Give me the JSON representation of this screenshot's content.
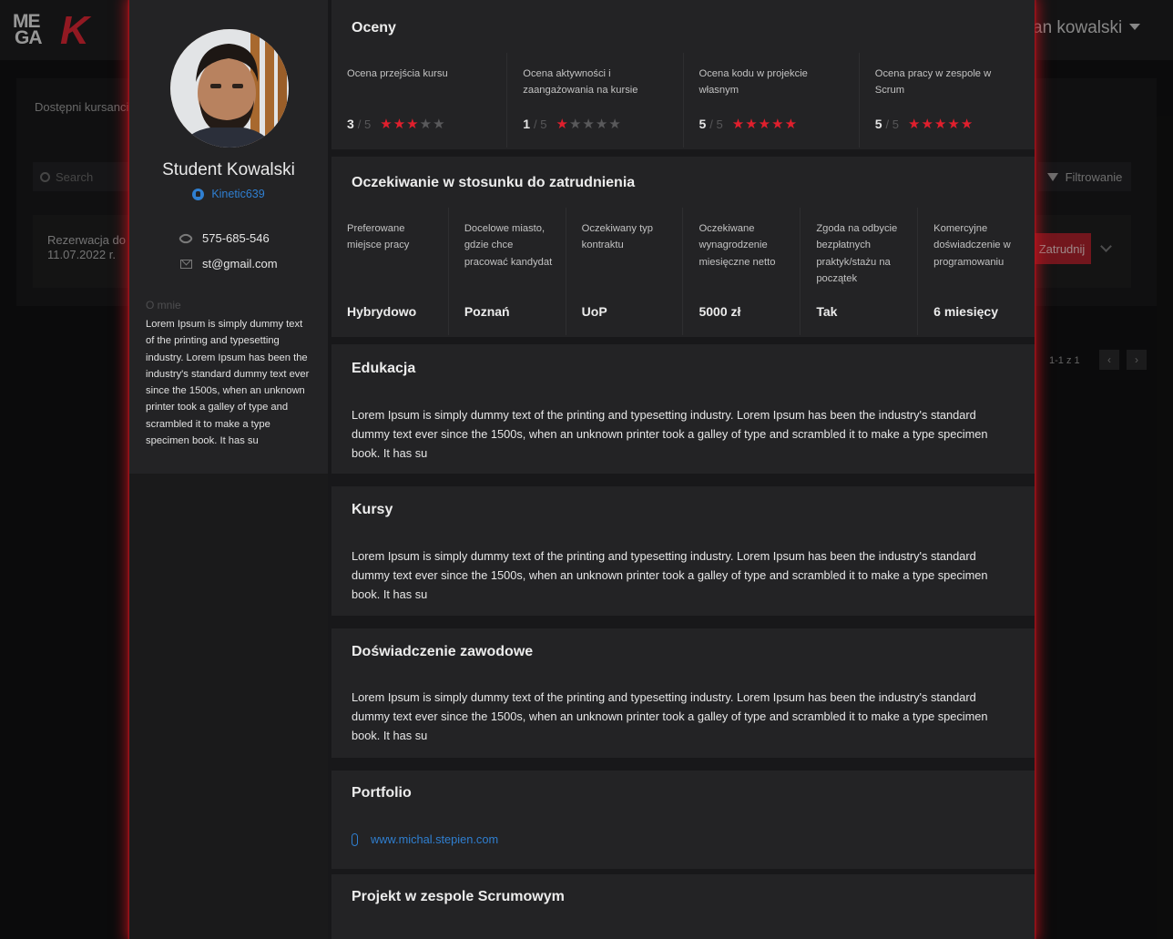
{
  "header": {
    "logo_line1": "ME",
    "logo_line2": "GA",
    "logo_k": "K",
    "user_name": "an kowalski"
  },
  "background": {
    "tab_label": "Dostępni kursanci",
    "search_placeholder": "Search",
    "filter_label": "Filtrowanie",
    "row_date": "Rezerwacja do 11.07.2022 r.",
    "hire_label": "Zatrudnij",
    "pager_text": "1-1 z 1"
  },
  "profile": {
    "name": "Student Kowalski",
    "github": "Kinetic639",
    "phone": "575-685-546",
    "email": "st@gmail.com",
    "about_title": "O mnie",
    "about_text": "Lorem Ipsum is simply dummy text of the printing and typesetting industry. Lorem Ipsum has been the industry's standard dummy text ever since the 1500s, when an unknown printer took a galley of type and scrambled it to make a type specimen book. It has su"
  },
  "grades": {
    "title": "Oceny",
    "max_label": "/ 5",
    "items": [
      {
        "label": "Ocena przejścia kursu",
        "value": "3",
        "score": 3
      },
      {
        "label": "Ocena aktywności i zaangażowania na kursie",
        "value": "1",
        "score": 1
      },
      {
        "label": "Ocena kodu w projekcie własnym",
        "value": "5",
        "score": 5
      },
      {
        "label": "Ocena pracy w zespole w Scrum",
        "value": "5",
        "score": 5
      }
    ]
  },
  "expectations": {
    "title": "Oczekiwanie w stosunku do zatrudnienia",
    "items": [
      {
        "label": "Preferowane miejsce pracy",
        "value": "Hybrydowo"
      },
      {
        "label": "Docelowe miasto, gdzie chce pracować kandydat",
        "value": "Poznań"
      },
      {
        "label": "Oczekiwany typ kontraktu",
        "value": "UoP"
      },
      {
        "label": "Oczekiwane wynagrodzenie miesięczne netto",
        "value": "5000 zł"
      },
      {
        "label": "Zgoda na odbycie bezpłatnych praktyk/stażu na początek",
        "value": "Tak"
      },
      {
        "label": "Komercyjne doświadczenie w programowaniu",
        "value": "6 miesięcy"
      }
    ]
  },
  "education": {
    "title": "Edukacja",
    "text": "Lorem Ipsum is simply dummy text of the printing and typesetting industry. Lorem Ipsum has been the industry's standard dummy text ever since the 1500s, when an unknown printer took a galley of type and scrambled it to make a type specimen book. It has su"
  },
  "courses": {
    "title": "Kursy",
    "text": "Lorem Ipsum is simply dummy text of the printing and typesetting industry. Lorem Ipsum has been the industry's standard dummy text ever since the 1500s, when an unknown printer took a galley of type and scrambled it to make a type specimen book. It has su"
  },
  "experience": {
    "title": "Doświadczenie zawodowe",
    "text": "Lorem Ipsum is simply dummy text of the printing and typesetting industry. Lorem Ipsum has been the industry's standard dummy text ever since the 1500s, when an unknown printer took a galley of type and scrambled it to make a type specimen book. It has su"
  },
  "portfolio": {
    "title": "Portfolio",
    "link": "www.michal.stepien.com"
  },
  "scrum_project": {
    "title": "Projekt w zespole Scrumowym"
  },
  "colors": {
    "accent": "#e01f2d",
    "link": "#2f7fd1"
  }
}
